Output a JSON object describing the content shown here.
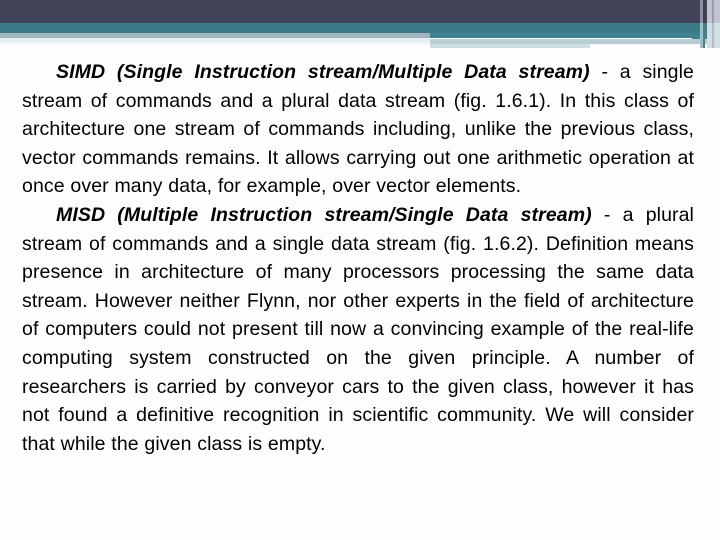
{
  "slide": {
    "background_color": "#fffdff",
    "decor": {
      "navy": "#414458",
      "teal": "#3d7a87",
      "steel": "#9fb4bc",
      "wash": "#e3ecef",
      "stripe_light": "#c3c3d2"
    },
    "paragraphs": [
      {
        "id": "simd",
        "heading": "SIMD (Single Instruction stream/Multiple Data stream)",
        "body": " - a single stream of commands and a plural data stream (fig. 1.6.1). In this class of architecture one stream of commands including, unlike the previous class, vector commands remains. It allows carrying out one arithmetic operation at once over many data, for example, over vector elements."
      },
      {
        "id": "misd",
        "heading": "MISD (Multiple Instruction stream/Single Data stream)",
        "body": " - a plural stream of commands and a single data stream (fig. 1.6.2). Definition means presence in architecture of many processors processing the same data stream. However neither Flynn, nor other experts in the field of architecture of computers could not present till now a convincing example of the real-life computing system constructed on the given principle. A number of researchers is carried by conveyor cars to the given class, however it has not found a definitive recognition in scientific community. We will consider that while the given class is empty."
      }
    ]
  }
}
